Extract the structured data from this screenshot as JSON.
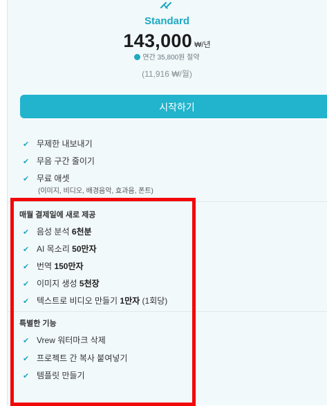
{
  "plan": {
    "name": "Standard",
    "price": "143,000",
    "unit": "₩/년",
    "saving": "연간 35,800원 절약",
    "monthly": "(11,916 ₩/월)"
  },
  "start_button": "시작하기",
  "basic_features": [
    "무제한 내보내기",
    "무음 구간 줄이기",
    "무료 애셋"
  ],
  "basic_note": "(이미지, 비디오, 배경음악, 효과음, 폰트)",
  "monthly_section": {
    "title": "매월 결제일에 새로 제공",
    "items": [
      {
        "label": "음성 분석",
        "value": "6천분",
        "suffix": ""
      },
      {
        "label": "AI 목소리",
        "value": "50만자",
        "suffix": ""
      },
      {
        "label": "번역",
        "value": "150만자",
        "suffix": ""
      },
      {
        "label": "이미지 생성",
        "value": "5천장",
        "suffix": ""
      },
      {
        "label": "텍스트로 비디오 만들기",
        "value": "1만자",
        "suffix": "(1회당)"
      }
    ]
  },
  "special_section": {
    "title": "특별한 기능",
    "items": [
      "Vrew 워터마크 삭제",
      "프로젝트 간 복사 붙여넣기",
      "템플릿 만들기"
    ]
  },
  "colors": {
    "accent": "#22b4cc",
    "highlight_box": "#f2080b",
    "card_bg": "#f2f9fb"
  },
  "icons": {
    "logo": "plan-sparkle-icon",
    "coin": "coin-icon",
    "check": "check-icon"
  }
}
